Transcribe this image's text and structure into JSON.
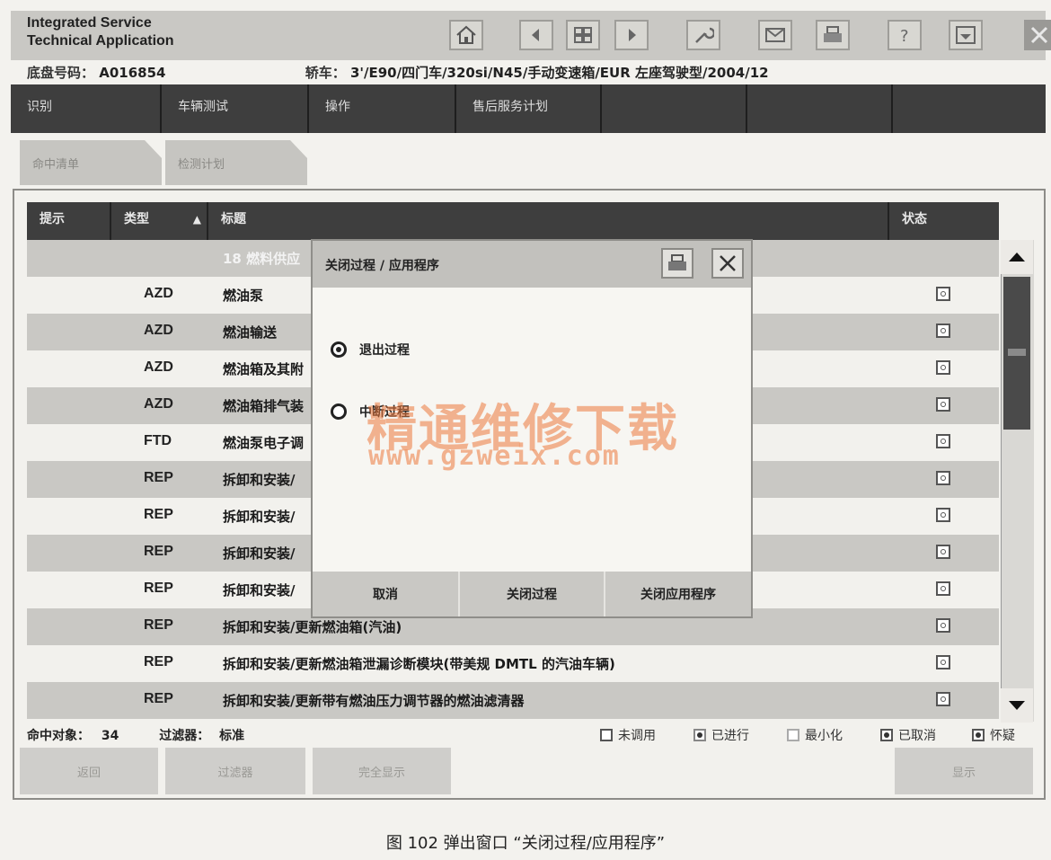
{
  "app": {
    "title_line1": "Integrated Service",
    "title_line2": "Technical Application"
  },
  "toolbar": {
    "icons": [
      "home-icon",
      "back-icon",
      "grid-icon",
      "forward-icon",
      "wrench-icon",
      "mail-icon",
      "printer-icon",
      "help-icon",
      "download-icon"
    ],
    "close": "close-icon"
  },
  "info": {
    "chassis_label": "底盘号码：",
    "chassis_value": "A016854",
    "vehicle_label": "轿车：",
    "vehicle_value": "3'/E90/四门车/320si/N45/手动变速箱/EUR 左座驾驶型/2004/12"
  },
  "nav": {
    "tabs": [
      "识别",
      "车辆测试",
      "操作",
      "售后服务计划",
      "",
      "",
      ""
    ]
  },
  "subtabs": [
    "命中清单",
    "检测计划"
  ],
  "table": {
    "headers": {
      "hint": "提示",
      "type": "类型",
      "title": "标题",
      "status": "状态"
    },
    "rows": [
      {
        "type": "",
        "title": "18 燃料供应"
      },
      {
        "type": "AZD",
        "title": "燃油泵"
      },
      {
        "type": "AZD",
        "title": "燃油输送"
      },
      {
        "type": "AZD",
        "title": "燃油箱及其附"
      },
      {
        "type": "AZD",
        "title": "燃油箱排气装"
      },
      {
        "type": "FTD",
        "title": "燃油泵电子调"
      },
      {
        "type": "REP",
        "title": "拆卸和安装/"
      },
      {
        "type": "REP",
        "title": "拆卸和安装/"
      },
      {
        "type": "REP",
        "title": "拆卸和安装/"
      },
      {
        "type": "REP",
        "title": "拆卸和安装/"
      },
      {
        "type": "REP",
        "title": "拆卸和安装/更新燃油箱(汽油)"
      },
      {
        "type": "REP",
        "title": "拆卸和安装/更新燃油箱泄漏诊断模块(带美规 DMTL 的汽油车辆)"
      },
      {
        "type": "REP",
        "title": "拆卸和安装/更新带有燃油压力调节器的燃油滤清器"
      }
    ]
  },
  "footer": {
    "hits_label": "命中对象：",
    "hits_value": "34",
    "filter_label": "过滤器：",
    "filter_value": "标准",
    "legend": [
      "未调用",
      "已进行",
      "最小化",
      "已取消",
      "怀疑"
    ]
  },
  "bottom_buttons": [
    "返回",
    "过滤器",
    "完全显示",
    "显示"
  ],
  "dialog": {
    "title": "关闭过程 / 应用程序",
    "options": [
      {
        "label": "退出过程",
        "selected": true
      },
      {
        "label": "中断过程",
        "selected": false
      }
    ],
    "buttons": [
      "取消",
      "关闭过程",
      "关闭应用程序"
    ]
  },
  "watermark": {
    "cn": "精通维修下载",
    "url": "www.gzweix.com"
  },
  "caption": "图 102   弹出窗口   “关闭过程/应用程序”"
}
